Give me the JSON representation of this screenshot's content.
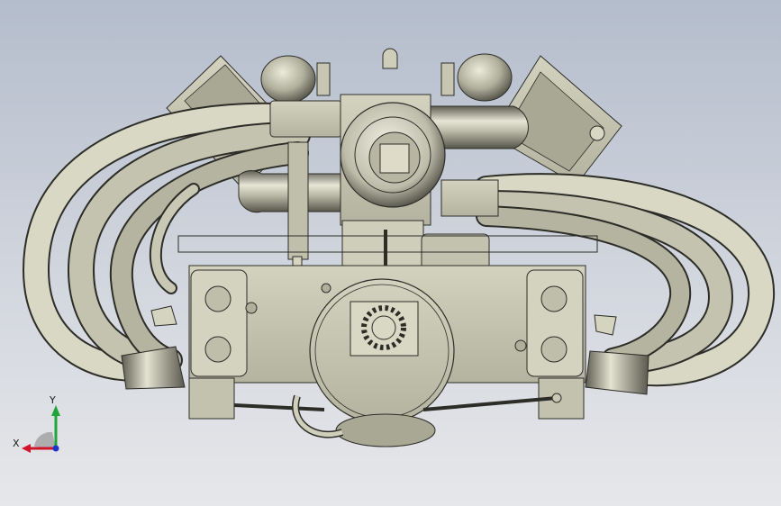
{
  "triad": {
    "x_label": "X",
    "y_label": "Y",
    "x_color": "#d0142a",
    "y_color": "#1fa63a",
    "z_color": "#1f35c8"
  },
  "colors": {
    "background_top": "#b4bdcc",
    "background_bottom": "#e6e7ea",
    "part_base": "#c9c8b4",
    "part_shadow": "#6e6d5e",
    "part_edge": "#2d2d28"
  },
  "icons": {
    "model": "engine-cad-model",
    "triad": "coordinate-triad-icon"
  }
}
